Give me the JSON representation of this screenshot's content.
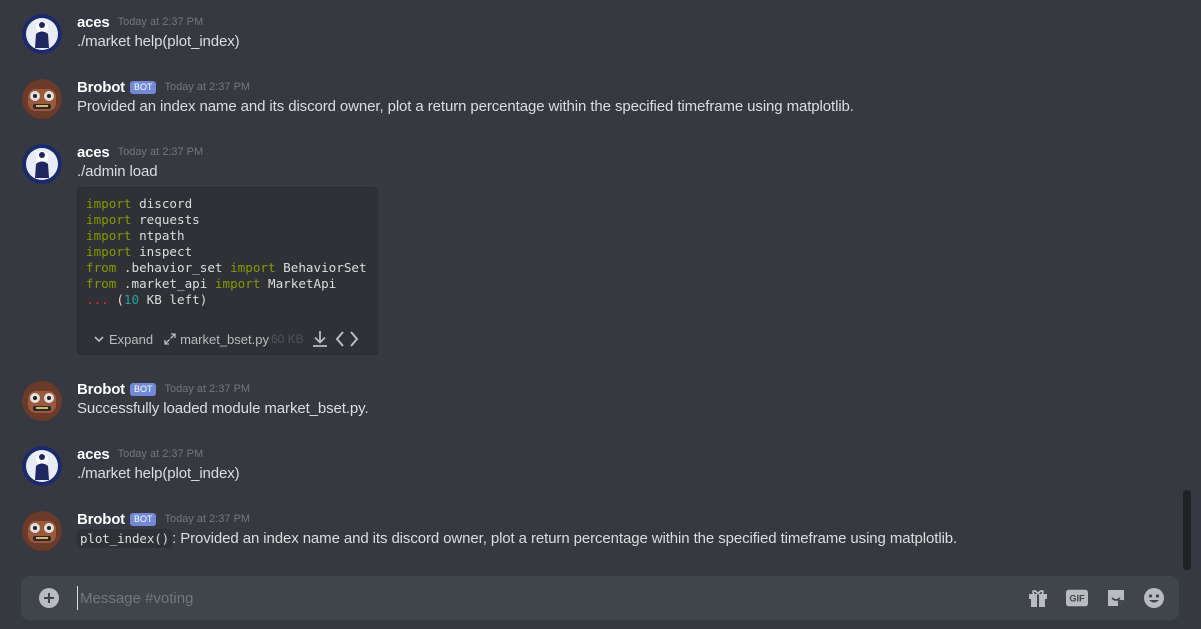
{
  "messages": [
    {
      "author": "aces",
      "is_bot": false,
      "timestamp": "Today at 2:37 PM",
      "text": "./market help(plot_index)"
    },
    {
      "author": "Brobot",
      "is_bot": true,
      "bot_tag": "BOT",
      "timestamp": "Today at 2:37 PM",
      "text": "Provided an index name and its discord owner, plot a return percentage within the specified timeframe using matplotlib."
    },
    {
      "author": "aces",
      "is_bot": false,
      "timestamp": "Today at 2:37 PM",
      "text": "./admin load",
      "attachment": {
        "code_lines": [
          "import discord",
          "import requests",
          "import ntpath",
          "import inspect",
          "from .behavior_set import BehaviorSet",
          "from .market_api import MarketApi",
          "... (10 KB left)"
        ],
        "expand_label": "Expand",
        "filename": "market_bset.py",
        "filesize": "60 KB"
      }
    },
    {
      "author": "Brobot",
      "is_bot": true,
      "bot_tag": "BOT",
      "timestamp": "Today at 2:37 PM",
      "text": "Successfully loaded module market_bset.py."
    },
    {
      "author": "aces",
      "is_bot": false,
      "timestamp": "Today at 2:37 PM",
      "text": "./market help(plot_index)"
    },
    {
      "author": "Brobot",
      "is_bot": true,
      "bot_tag": "BOT",
      "timestamp": "Today at 2:37 PM",
      "inline_code": "plot_index()",
      "text": ": Provided an index name and its discord owner, plot a return percentage within the specified timeframe using matplotlib."
    }
  ],
  "composer": {
    "placeholder": "Message #voting",
    "icons": [
      "add-icon",
      "gift-icon",
      "gif-icon",
      "sticker-icon",
      "emoji-icon"
    ],
    "gif_label": "GIF"
  },
  "colors": {
    "background": "#36393f",
    "bot_tag": "#7289da",
    "composer": "#40444b",
    "keyword": "#859900"
  }
}
